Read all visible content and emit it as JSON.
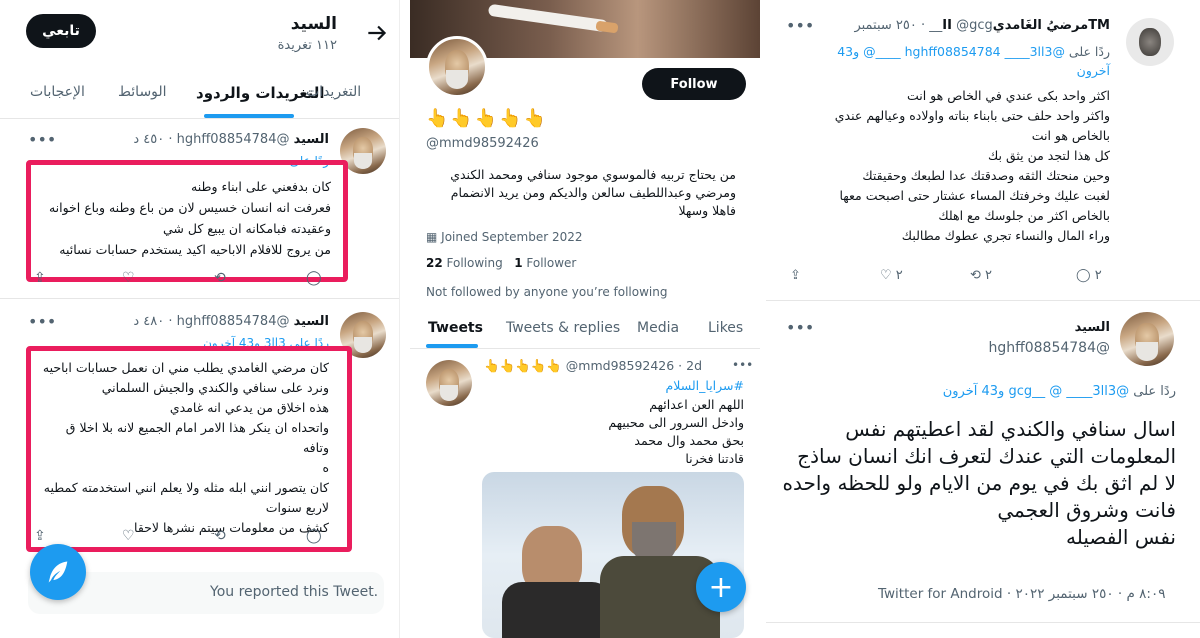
{
  "left": {
    "header": {
      "name": "السيد",
      "count": "١١٢ تغريدة",
      "follow_label": "تابعي"
    },
    "tabs": [
      "الإعجابات",
      "الوسائط",
      "التغريدات والردود",
      "التغريدات"
    ],
    "tweet1": {
      "name": "السيد",
      "handle": "@hghff08854784",
      "time": "٤٥٠ د",
      "reply_to": "ردًا على",
      "lines": [
        "كان بدفعني على ابناء وطنه",
        "فعرفت انه انسان خسيس  لان من باع وطنه وباع اخوانه",
        "وعقيدته فبامكانه ان يبيع كل شي",
        "من يروج للافلام الاباحيه اكيد يستخدم حسابات نسائيه"
      ]
    },
    "tweet2": {
      "name": "السيد",
      "handle": "@hghff08854784",
      "time": "٤٨٠ د",
      "reply_to": "ردًا على",
      "mention": "3ll3",
      "others": "و43 آخرون",
      "lines": [
        "كان مرضي الغامدي يطلب مني ان نعمل حسابات اباحيه",
        "ونرد على سنافي والكندي والجيش السلماني",
        "هذه اخلاق من يدعي انه غامدي",
        "واتحداه ان ينكر هذا الامر امام الجميع لانه بلا اخلا ق وتافه",
        "ه",
        "كان يتصور انني ابله مثله ولا يعلم انني استخدمته كمطيه",
        "لاربع سنوات",
        "كشف من معلومات  سيتم نشرها لاحقا"
      ]
    },
    "reported": "You reported this Tweet."
  },
  "middle": {
    "follow_label": "Follow",
    "emojis": "👆👆👆👆👆",
    "handle": "@mmd98592426",
    "bio": [
      "من يحتاج تربيه فالموسوي موجود سنافي ومحمد الكندي",
      "ومرضي وعبداللطيف سالعن والديكم ومن يريد الانضمام",
      "فاهلا وسهلا"
    ],
    "joined": "Joined September 2022",
    "following_count": "22",
    "following_label": "Following",
    "followers_count": "1",
    "followers_label": "Follower",
    "not_followed": "Not followed by anyone you’re following",
    "tabs": [
      "Tweets",
      "Tweets & replies",
      "Media",
      "Likes"
    ],
    "tweet": {
      "header": "👆👆👆👆👆 @mmd98592426 · 2d",
      "hashtag": "#سرايا_السلام",
      "lines": [
        "اللهم العن اعدائهم",
        "وادخل السرور الى محبيهم",
        "بحق محمد وال محمد",
        "قادتنا فخرنا"
      ]
    }
  },
  "right": {
    "tweet1": {
      "name": "TMمرضيُ الغَامديII",
      "handle": "@gcg__",
      "time": "٢٥٠ سبتمبر",
      "reply_to": "ردًا على",
      "mentions": "@hghff08854784 ____3ll3 ____@ و43",
      "others": "آخرون",
      "lines": [
        "اكثر واحد بكى عندي في الخاص هو انت",
        "واكثر واحد حلف حتى بابناء بناته واولاده وعيالهم عندي",
        "بالخاص هو انت",
        "كل هذا لتجد من يثق بك",
        "وحين منحتك الثقه وصدقتك عدا لطبعك وحقيقتك",
        "لغبت عليك وخرفتك المساء عشتار حتى اصبحت معها",
        "بالخاص اكثر من جلوسك مع اهلك",
        "وراء المال والنساء تجري عطوك مطالبك"
      ],
      "stats": {
        "replies": "٢",
        "retweets": "٢",
        "likes": "٢"
      }
    },
    "tweet2": {
      "name": "السيد",
      "handle": "@hghff08854784",
      "reply_to": "ردًا على",
      "mentions": "@gcg__ @ ____3ll3 و43 آخرون",
      "lines": [
        "اسال سنافي والكندي لقد اعطيتهم نفس",
        "المعلومات التي عندك لتعرف انك انسان ساذج",
        "لا لم اثق بك في يوم من الايام ولو للحظه واحده",
        "فانت وشروق العجمي",
        "نفس الفصيله"
      ],
      "footer": "٨:٠٩ م · ٢٥٠ سبتمبر ٢٠٢٢ · Twitter for Android"
    }
  }
}
